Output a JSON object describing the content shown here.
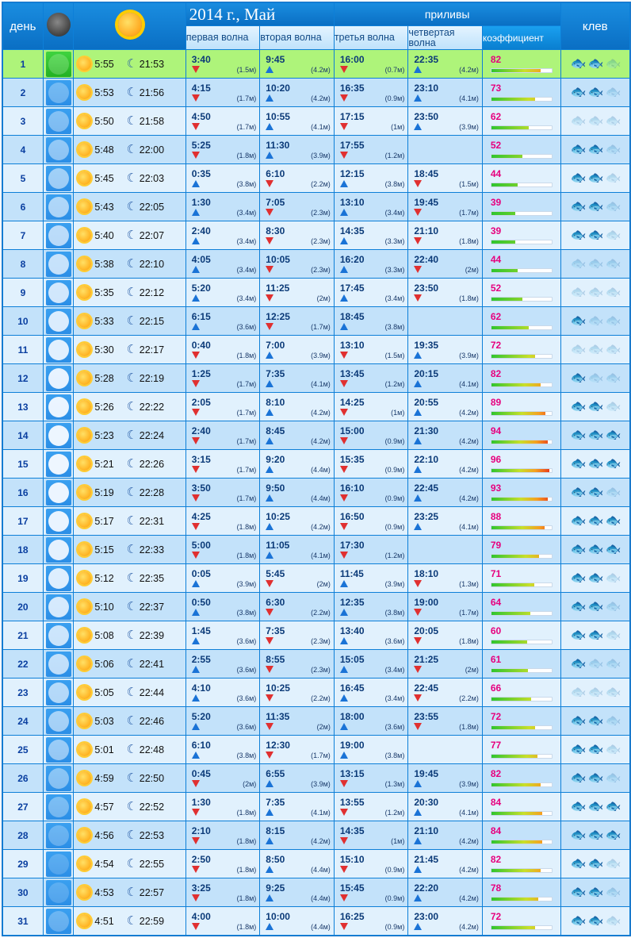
{
  "header": {
    "day_label": "день",
    "title": "2014 г., Май",
    "tides_label": "приливы",
    "wave1": "первая волна",
    "wave2": "вторая волна",
    "wave3": "третья волна",
    "wave4": "четвертая волна",
    "coef_label": "коэффициент",
    "klev_label": "клев"
  },
  "rows": [
    {
      "day": "1",
      "sunrise": "5:55",
      "moonset": "21:53",
      "tides": [
        [
          "3:40",
          "down",
          "(1.5м)"
        ],
        [
          "9:45",
          "up",
          "(4.2м)"
        ],
        [
          "16:00",
          "down",
          "(0.7м)"
        ],
        [
          "22:35",
          "up",
          "(4.2м)"
        ]
      ],
      "coef": "82",
      "coef_pct": 82,
      "fish": [
        1,
        1,
        0
      ],
      "selected": true
    },
    {
      "day": "2",
      "sunrise": "5:53",
      "moonset": "21:56",
      "tides": [
        [
          "4:15",
          "down",
          "(1.7м)"
        ],
        [
          "10:20",
          "up",
          "(4.2м)"
        ],
        [
          "16:35",
          "down",
          "(0.9м)"
        ],
        [
          "23:10",
          "up",
          "(4.1м)"
        ]
      ],
      "coef": "73",
      "coef_pct": 73,
      "fish": [
        1,
        1,
        0
      ]
    },
    {
      "day": "3",
      "sunrise": "5:50",
      "moonset": "21:58",
      "tides": [
        [
          "4:50",
          "down",
          "(1.7м)"
        ],
        [
          "10:55",
          "up",
          "(4.1м)"
        ],
        [
          "17:15",
          "down",
          "(1м)"
        ],
        [
          "23:50",
          "up",
          "(3.9м)"
        ]
      ],
      "coef": "62",
      "coef_pct": 62,
      "fish": [
        0,
        0,
        0
      ]
    },
    {
      "day": "4",
      "sunrise": "5:48",
      "moonset": "22:00",
      "tides": [
        [
          "5:25",
          "down",
          "(1.8м)"
        ],
        [
          "11:30",
          "up",
          "(3.9м)"
        ],
        [
          "17:55",
          "down",
          "(1.2м)"
        ],
        [
          "",
          "",
          ""
        ]
      ],
      "coef": "52",
      "coef_pct": 52,
      "fish": [
        1,
        1,
        0
      ]
    },
    {
      "day": "5",
      "sunrise": "5:45",
      "moonset": "22:03",
      "tides": [
        [
          "0:35",
          "up",
          "(3.8м)"
        ],
        [
          "6:10",
          "down",
          "(2.2м)"
        ],
        [
          "12:15",
          "up",
          "(3.8м)"
        ],
        [
          "18:45",
          "down",
          "(1.5м)"
        ]
      ],
      "coef": "44",
      "coef_pct": 44,
      "fish": [
        1,
        1,
        0
      ]
    },
    {
      "day": "6",
      "sunrise": "5:43",
      "moonset": "22:05",
      "tides": [
        [
          "1:30",
          "up",
          "(3.4м)"
        ],
        [
          "7:05",
          "down",
          "(2.3м)"
        ],
        [
          "13:10",
          "up",
          "(3.4м)"
        ],
        [
          "19:45",
          "down",
          "(1.7м)"
        ]
      ],
      "coef": "39",
      "coef_pct": 39,
      "fish": [
        1,
        1,
        0
      ]
    },
    {
      "day": "7",
      "sunrise": "5:40",
      "moonset": "22:07",
      "tides": [
        [
          "2:40",
          "up",
          "(3.4м)"
        ],
        [
          "8:30",
          "down",
          "(2.3м)"
        ],
        [
          "14:35",
          "up",
          "(3.3м)"
        ],
        [
          "21:10",
          "down",
          "(1.8м)"
        ]
      ],
      "coef": "39",
      "coef_pct": 39,
      "fish": [
        1,
        1,
        0
      ]
    },
    {
      "day": "8",
      "sunrise": "5:38",
      "moonset": "22:10",
      "tides": [
        [
          "4:05",
          "up",
          "(3.4м)"
        ],
        [
          "10:05",
          "down",
          "(2.3м)"
        ],
        [
          "16:20",
          "up",
          "(3.3м)"
        ],
        [
          "22:40",
          "down",
          "(2м)"
        ]
      ],
      "coef": "44",
      "coef_pct": 44,
      "fish": [
        0,
        0,
        0
      ]
    },
    {
      "day": "9",
      "sunrise": "5:35",
      "moonset": "22:12",
      "tides": [
        [
          "5:20",
          "up",
          "(3.4м)"
        ],
        [
          "11:25",
          "down",
          "(2м)"
        ],
        [
          "17:45",
          "up",
          "(3.4м)"
        ],
        [
          "23:50",
          "down",
          "(1.8м)"
        ]
      ],
      "coef": "52",
      "coef_pct": 52,
      "fish": [
        0,
        0,
        0
      ]
    },
    {
      "day": "10",
      "sunrise": "5:33",
      "moonset": "22:15",
      "tides": [
        [
          "6:15",
          "up",
          "(3.6м)"
        ],
        [
          "12:25",
          "down",
          "(1.7м)"
        ],
        [
          "18:45",
          "up",
          "(3.8м)"
        ],
        [
          "",
          "",
          ""
        ]
      ],
      "coef": "62",
      "coef_pct": 62,
      "fish": [
        1,
        0,
        0
      ]
    },
    {
      "day": "11",
      "sunrise": "5:30",
      "moonset": "22:17",
      "tides": [
        [
          "0:40",
          "down",
          "(1.8м)"
        ],
        [
          "7:00",
          "up",
          "(3.9м)"
        ],
        [
          "13:10",
          "down",
          "(1.5м)"
        ],
        [
          "19:35",
          "up",
          "(3.9м)"
        ]
      ],
      "coef": "72",
      "coef_pct": 72,
      "fish": [
        0,
        0,
        0
      ]
    },
    {
      "day": "12",
      "sunrise": "5:28",
      "moonset": "22:19",
      "tides": [
        [
          "1:25",
          "down",
          "(1.7м)"
        ],
        [
          "7:35",
          "up",
          "(4.1м)"
        ],
        [
          "13:45",
          "down",
          "(1.2м)"
        ],
        [
          "20:15",
          "up",
          "(4.1м)"
        ]
      ],
      "coef": "82",
      "coef_pct": 82,
      "fish": [
        1,
        0,
        0
      ]
    },
    {
      "day": "13",
      "sunrise": "5:26",
      "moonset": "22:22",
      "tides": [
        [
          "2:05",
          "down",
          "(1.7м)"
        ],
        [
          "8:10",
          "up",
          "(4.2м)"
        ],
        [
          "14:25",
          "down",
          "(1м)"
        ],
        [
          "20:55",
          "up",
          "(4.2м)"
        ]
      ],
      "coef": "89",
      "coef_pct": 89,
      "fish": [
        1,
        1,
        0
      ]
    },
    {
      "day": "14",
      "sunrise": "5:23",
      "moonset": "22:24",
      "tides": [
        [
          "2:40",
          "down",
          "(1.7м)"
        ],
        [
          "8:45",
          "up",
          "(4.2м)"
        ],
        [
          "15:00",
          "down",
          "(0.9м)"
        ],
        [
          "21:30",
          "up",
          "(4.2м)"
        ]
      ],
      "coef": "94",
      "coef_pct": 94,
      "fish": [
        1,
        1,
        1
      ]
    },
    {
      "day": "15",
      "sunrise": "5:21",
      "moonset": "22:26",
      "tides": [
        [
          "3:15",
          "down",
          "(1.7м)"
        ],
        [
          "9:20",
          "up",
          "(4.4м)"
        ],
        [
          "15:35",
          "down",
          "(0.9м)"
        ],
        [
          "22:10",
          "up",
          "(4.2м)"
        ]
      ],
      "coef": "96",
      "coef_pct": 96,
      "fish": [
        1,
        1,
        1
      ]
    },
    {
      "day": "16",
      "sunrise": "5:19",
      "moonset": "22:28",
      "tides": [
        [
          "3:50",
          "down",
          "(1.7м)"
        ],
        [
          "9:50",
          "up",
          "(4.4м)"
        ],
        [
          "16:10",
          "down",
          "(0.9м)"
        ],
        [
          "22:45",
          "up",
          "(4.2м)"
        ]
      ],
      "coef": "93",
      "coef_pct": 93,
      "fish": [
        1,
        1,
        0
      ]
    },
    {
      "day": "17",
      "sunrise": "5:17",
      "moonset": "22:31",
      "tides": [
        [
          "4:25",
          "down",
          "(1.8м)"
        ],
        [
          "10:25",
          "up",
          "(4.2м)"
        ],
        [
          "16:50",
          "down",
          "(0.9м)"
        ],
        [
          "23:25",
          "up",
          "(4.1м)"
        ]
      ],
      "coef": "88",
      "coef_pct": 88,
      "fish": [
        1,
        1,
        1
      ]
    },
    {
      "day": "18",
      "sunrise": "5:15",
      "moonset": "22:33",
      "tides": [
        [
          "5:00",
          "down",
          "(1.8м)"
        ],
        [
          "11:05",
          "up",
          "(4.1м)"
        ],
        [
          "17:30",
          "down",
          "(1.2м)"
        ],
        [
          "",
          "",
          ""
        ]
      ],
      "coef": "79",
      "coef_pct": 79,
      "fish": [
        1,
        1,
        1
      ]
    },
    {
      "day": "19",
      "sunrise": "5:12",
      "moonset": "22:35",
      "tides": [
        [
          "0:05",
          "up",
          "(3.9м)"
        ],
        [
          "5:45",
          "down",
          "(2м)"
        ],
        [
          "11:45",
          "up",
          "(3.9м)"
        ],
        [
          "18:10",
          "down",
          "(1.3м)"
        ]
      ],
      "coef": "71",
      "coef_pct": 71,
      "fish": [
        1,
        1,
        0
      ]
    },
    {
      "day": "20",
      "sunrise": "5:10",
      "moonset": "22:37",
      "tides": [
        [
          "0:50",
          "up",
          "(3.8м)"
        ],
        [
          "6:30",
          "down",
          "(2.2м)"
        ],
        [
          "12:35",
          "up",
          "(3.8м)"
        ],
        [
          "19:00",
          "down",
          "(1.7м)"
        ]
      ],
      "coef": "64",
      "coef_pct": 64,
      "fish": [
        1,
        1,
        0
      ]
    },
    {
      "day": "21",
      "sunrise": "5:08",
      "moonset": "22:39",
      "tides": [
        [
          "1:45",
          "up",
          "(3.6м)"
        ],
        [
          "7:35",
          "down",
          "(2.3м)"
        ],
        [
          "13:40",
          "up",
          "(3.6м)"
        ],
        [
          "20:05",
          "down",
          "(1.8м)"
        ]
      ],
      "coef": "60",
      "coef_pct": 60,
      "fish": [
        1,
        1,
        0
      ]
    },
    {
      "day": "22",
      "sunrise": "5:06",
      "moonset": "22:41",
      "tides": [
        [
          "2:55",
          "up",
          "(3.6м)"
        ],
        [
          "8:55",
          "down",
          "(2.3м)"
        ],
        [
          "15:05",
          "up",
          "(3.4м)"
        ],
        [
          "21:25",
          "down",
          "(2м)"
        ]
      ],
      "coef": "61",
      "coef_pct": 61,
      "fish": [
        1,
        0,
        0
      ]
    },
    {
      "day": "23",
      "sunrise": "5:05",
      "moonset": "22:44",
      "tides": [
        [
          "4:10",
          "up",
          "(3.6м)"
        ],
        [
          "10:25",
          "down",
          "(2.2м)"
        ],
        [
          "16:45",
          "up",
          "(3.4м)"
        ],
        [
          "22:45",
          "down",
          "(2.2м)"
        ]
      ],
      "coef": "66",
      "coef_pct": 66,
      "fish": [
        0,
        0,
        0
      ]
    },
    {
      "day": "24",
      "sunrise": "5:03",
      "moonset": "22:46",
      "tides": [
        [
          "5:20",
          "up",
          "(3.6м)"
        ],
        [
          "11:35",
          "down",
          "(2м)"
        ],
        [
          "18:00",
          "up",
          "(3.6м)"
        ],
        [
          "23:55",
          "down",
          "(1.8м)"
        ]
      ],
      "coef": "72",
      "coef_pct": 72,
      "fish": [
        1,
        1,
        0
      ]
    },
    {
      "day": "25",
      "sunrise": "5:01",
      "moonset": "22:48",
      "tides": [
        [
          "6:10",
          "up",
          "(3.8м)"
        ],
        [
          "12:30",
          "down",
          "(1.7м)"
        ],
        [
          "19:00",
          "up",
          "(3.8м)"
        ],
        [
          "",
          "",
          ""
        ]
      ],
      "coef": "77",
      "coef_pct": 77,
      "fish": [
        1,
        1,
        0
      ]
    },
    {
      "day": "26",
      "sunrise": "4:59",
      "moonset": "22:50",
      "tides": [
        [
          "0:45",
          "down",
          "(2м)"
        ],
        [
          "6:55",
          "up",
          "(3.9м)"
        ],
        [
          "13:15",
          "down",
          "(1.3м)"
        ],
        [
          "19:45",
          "up",
          "(3.9м)"
        ]
      ],
      "coef": "82",
      "coef_pct": 82,
      "fish": [
        1,
        1,
        0
      ]
    },
    {
      "day": "27",
      "sunrise": "4:57",
      "moonset": "22:52",
      "tides": [
        [
          "1:30",
          "down",
          "(1.8м)"
        ],
        [
          "7:35",
          "up",
          "(4.1м)"
        ],
        [
          "13:55",
          "down",
          "(1.2м)"
        ],
        [
          "20:30",
          "up",
          "(4.1м)"
        ]
      ],
      "coef": "84",
      "coef_pct": 84,
      "fish": [
        1,
        1,
        1
      ]
    },
    {
      "day": "28",
      "sunrise": "4:56",
      "moonset": "22:53",
      "tides": [
        [
          "2:10",
          "down",
          "(1.8м)"
        ],
        [
          "8:15",
          "up",
          "(4.2м)"
        ],
        [
          "14:35",
          "down",
          "(1м)"
        ],
        [
          "21:10",
          "up",
          "(4.2м)"
        ]
      ],
      "coef": "84",
      "coef_pct": 84,
      "fish": [
        1,
        1,
        1
      ]
    },
    {
      "day": "29",
      "sunrise": "4:54",
      "moonset": "22:55",
      "tides": [
        [
          "2:50",
          "down",
          "(1.8м)"
        ],
        [
          "8:50",
          "up",
          "(4.4м)"
        ],
        [
          "15:10",
          "down",
          "(0.9м)"
        ],
        [
          "21:45",
          "up",
          "(4.2м)"
        ]
      ],
      "coef": "82",
      "coef_pct": 82,
      "fish": [
        1,
        1,
        0
      ]
    },
    {
      "day": "30",
      "sunrise": "4:53",
      "moonset": "22:57",
      "tides": [
        [
          "3:25",
          "down",
          "(1.8м)"
        ],
        [
          "9:25",
          "up",
          "(4.4м)"
        ],
        [
          "15:45",
          "down",
          "(0.9м)"
        ],
        [
          "22:20",
          "up",
          "(4.2м)"
        ]
      ],
      "coef": "78",
      "coef_pct": 78,
      "fish": [
        1,
        1,
        0
      ]
    },
    {
      "day": "31",
      "sunrise": "4:51",
      "moonset": "22:59",
      "tides": [
        [
          "4:00",
          "down",
          "(1.8м)"
        ],
        [
          "10:00",
          "up",
          "(4.4м)"
        ],
        [
          "16:25",
          "down",
          "(0.9м)"
        ],
        [
          "23:00",
          "up",
          "(4.2м)"
        ]
      ],
      "coef": "72",
      "coef_pct": 72,
      "fish": [
        1,
        1,
        0
      ]
    }
  ],
  "icons": {
    "sun": "sun-icon",
    "moon": "crescent-moon-icon",
    "fish": "fish-icon",
    "full_moon": "full-moon-icon",
    "tide_up": "arrow-up-icon",
    "tide_down": "arrow-down-icon"
  }
}
